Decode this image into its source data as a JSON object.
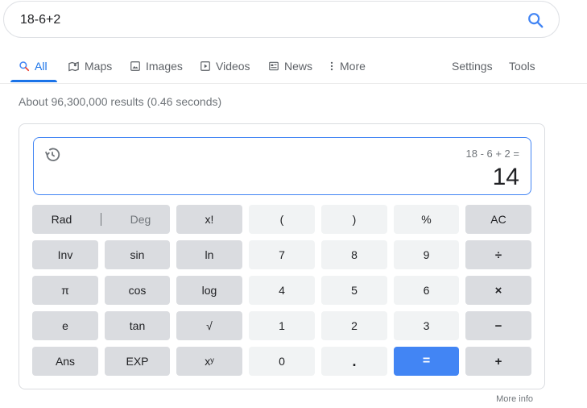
{
  "search": {
    "query": "18-6+2"
  },
  "tabs": [
    {
      "label": "All",
      "icon": "search-icon",
      "active": true
    },
    {
      "label": "Maps",
      "icon": "map-icon"
    },
    {
      "label": "Images",
      "icon": "image-icon"
    },
    {
      "label": "Videos",
      "icon": "video-icon"
    },
    {
      "label": "News",
      "icon": "news-icon"
    },
    {
      "label": "More",
      "icon": "more-vert-icon"
    },
    {
      "label": "Settings"
    },
    {
      "label": "Tools"
    }
  ],
  "result_stats": "About 96,300,000 results (0.46 seconds)",
  "calculator": {
    "expression": "18 - 6 + 2 =",
    "result": "14",
    "rad_label": "Rad",
    "deg_label": "Deg",
    "keys": [
      [
        "x!",
        "(",
        ")",
        "%",
        "AC"
      ],
      [
        "Inv",
        "sin",
        "ln",
        "7",
        "8",
        "9",
        "÷"
      ],
      [
        "π",
        "cos",
        "log",
        "4",
        "5",
        "6",
        "×"
      ],
      [
        "e",
        "tan",
        "√",
        "1",
        "2",
        "3",
        "−"
      ],
      [
        "Ans",
        "EXP",
        "xʸ",
        "0",
        ".",
        "=",
        "+"
      ]
    ]
  },
  "more_info": "More info",
  "colors": {
    "accent": "#1a73e8",
    "equals_key": "#4285f4",
    "function_key": "#dadce0",
    "number_key": "#f1f3f4"
  }
}
